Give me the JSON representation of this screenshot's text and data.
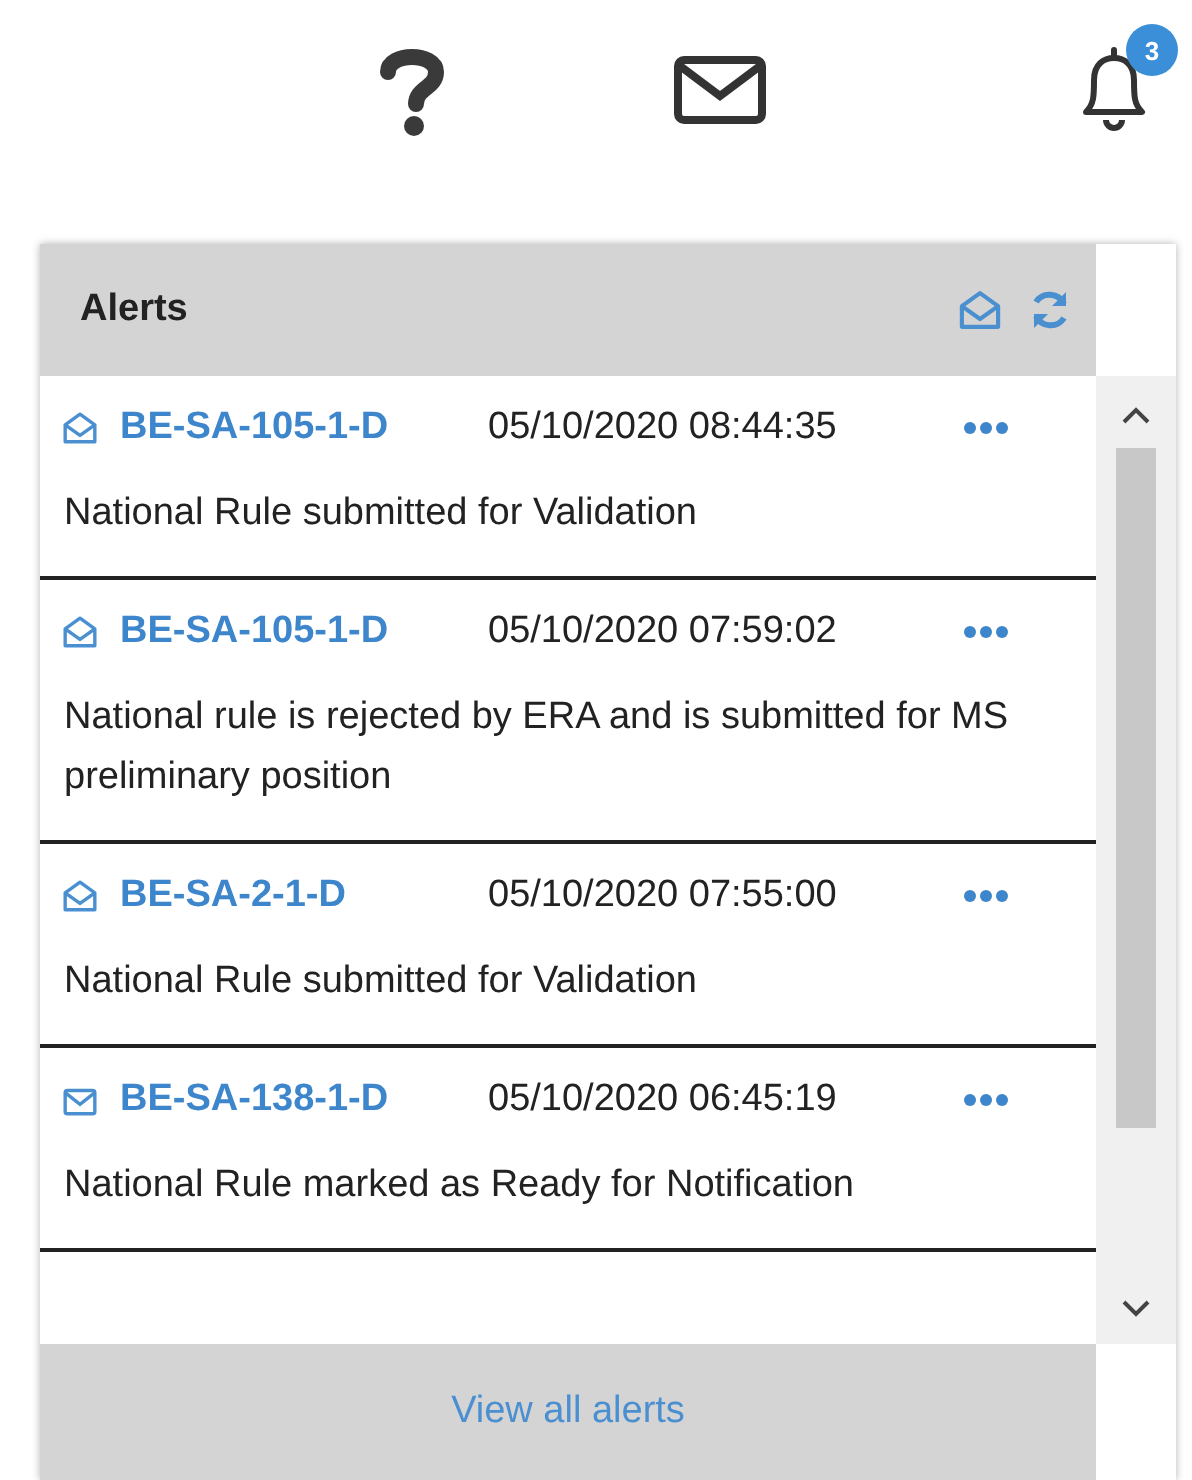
{
  "toolbar": {
    "notification_count": "3"
  },
  "alerts_panel": {
    "title": "Alerts",
    "items": [
      {
        "code": "BE-SA-105-1-D",
        "time": "05/10/2020 08:44:35",
        "message": "National Rule submitted for Validation",
        "read": true
      },
      {
        "code": "BE-SA-105-1-D",
        "time": "05/10/2020 07:59:02",
        "message": "National rule is rejected by ERA and is submitted for MS preliminary position",
        "read": true
      },
      {
        "code": "BE-SA-2-1-D",
        "time": "05/10/2020 07:55:00",
        "message": "National Rule submitted for Validation",
        "read": true
      },
      {
        "code": "BE-SA-138-1-D",
        "time": "05/10/2020 06:45:19",
        "message": "National Rule marked as Ready for Notification",
        "read": false
      }
    ],
    "footer_link": "View all alerts"
  }
}
